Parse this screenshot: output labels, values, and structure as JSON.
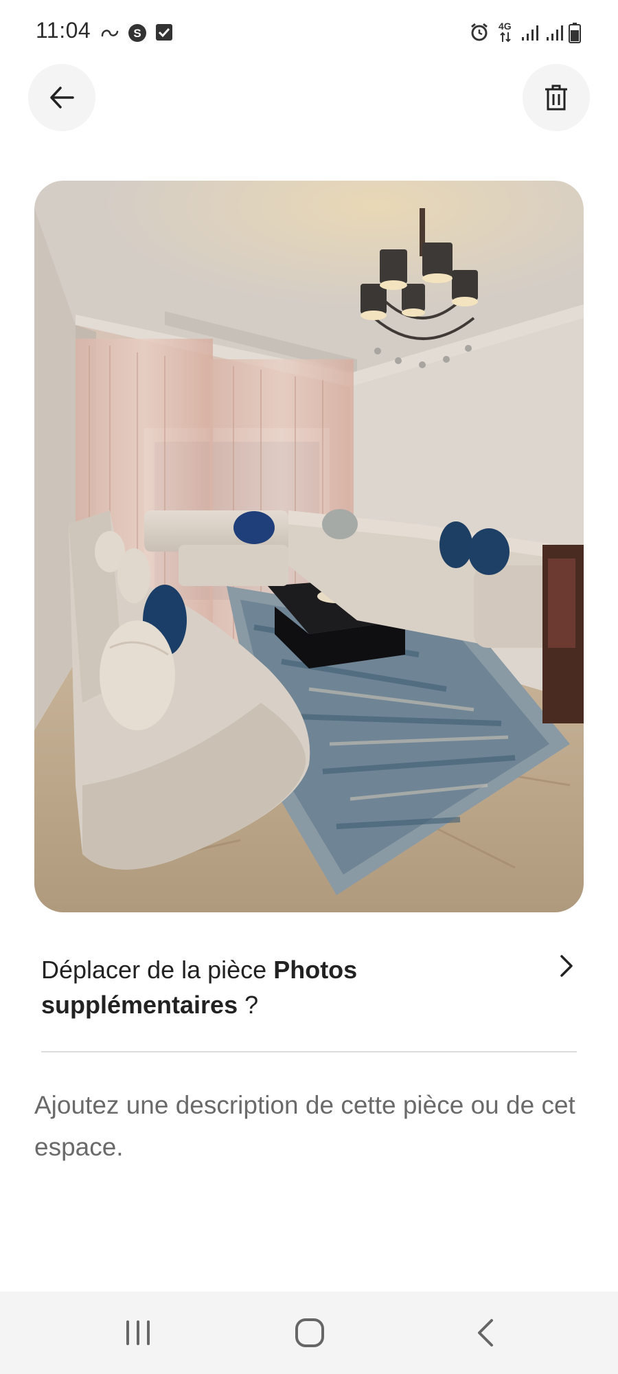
{
  "status_bar": {
    "time": "11:04",
    "network_label": "4G",
    "icons": [
      "link-icon",
      "s-badge-icon",
      "checkbox-icon",
      "alarm-icon",
      "data-arrows-icon",
      "signal-icon",
      "signal-icon",
      "battery-icon"
    ]
  },
  "toolbar": {
    "back_icon": "arrow-left-icon",
    "delete_icon": "trash-icon"
  },
  "photo": {
    "subject": "living-room-photo"
  },
  "move": {
    "prefix": "Déplacer de la pièce ",
    "room_name": "Photos supplémentaires",
    "suffix": " ?"
  },
  "description": {
    "placeholder": "Ajoutez une description de cette pièce ou de cet espace."
  },
  "nav_bar": {
    "buttons": [
      "recents-icon",
      "home-icon",
      "back-chevron-icon"
    ]
  },
  "colors": {
    "button_bg": "#f4f4f4",
    "divider": "#dddddd",
    "placeholder_text": "#6a6a6a",
    "nav_bg": "#f4f4f4"
  }
}
